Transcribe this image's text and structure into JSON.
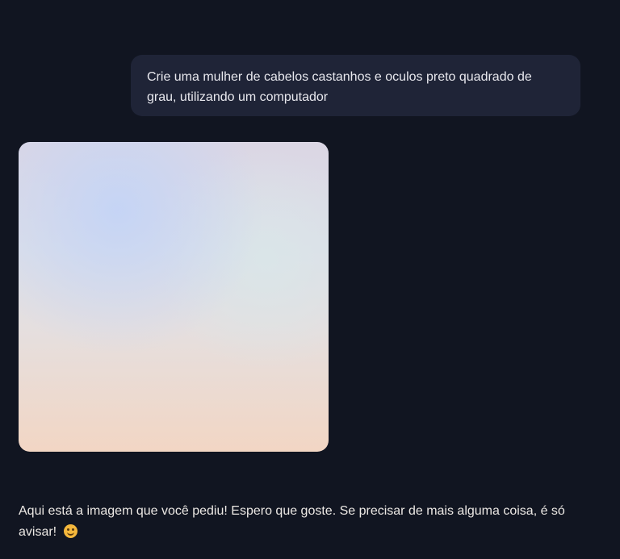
{
  "conversation": {
    "user_message": {
      "text": "Crie uma mulher de cabelos castanhos e oculos preto quadrado de grau, utilizando um computador"
    },
    "assistant_image": {
      "colors": {
        "top": "#dbd6e4",
        "highlight": "#c4d4f6",
        "bottom": "#f2d6c4"
      }
    },
    "assistant_message": {
      "text": "Aqui está a imagem que você pediu! Espero que goste. Se precisar de mais alguma coisa, é só avisar!",
      "emoji": "smiling-face-icon"
    }
  },
  "theme": {
    "background": "#111521",
    "user_bubble": "#1f2437",
    "text": "#e8e8ee"
  }
}
